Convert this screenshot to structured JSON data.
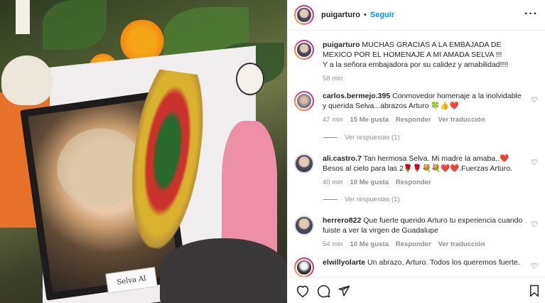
{
  "post": {
    "username": "puigarturo",
    "follow_label": "Seguir",
    "separator": "•",
    "nameplate_text": "Selva Al",
    "caption_line1": "MUCHAS GRACIAS A LA EMBAJADA DE MEXICO POR EL HOMENAJE A MI AMADA SELVA !!!",
    "caption_line2": "Y a la señora embajadora por su calidez y amabilidad!!!!",
    "caption_time": "58 min"
  },
  "comments": [
    {
      "username": "carlos.bermejo.395",
      "text": "Conmovedor homenaje a la inolvidable y querida Selva...abrazos Arturo 🍀👍❤️",
      "time": "47 min",
      "likes": "15 Me gusta",
      "reply": "Responder",
      "translate": "Ver traducción",
      "replies_label": "Ver respuestas (1)"
    },
    {
      "username": "ali.castro.7",
      "text": "Tan hermosa Selva. Mi madre la amaba..❤️Besos al cielo para las 2🌹🌹💐💐❤️❤️.Fuerzas Arturo.",
      "time": "40 min",
      "likes": "10 Me gusta",
      "reply": "Responder",
      "translate": "",
      "replies_label": "Ver respuestas (1)"
    },
    {
      "username": "herrero822",
      "text": "Que fuerte querido Arturo tu experiencia cuando fuiste a ver la virgen de Guadalupe",
      "time": "54 min",
      "likes": "10 Me gusta",
      "reply": "Responder",
      "translate": "Ver traducción"
    },
    {
      "username": "elwillyolarte",
      "text": "Un abrazo, Arturo. Todos los queremos fuerte."
    }
  ],
  "icons": {
    "more": "more-options-icon",
    "heart": "heart-icon",
    "comment": "comment-icon",
    "share": "share-icon",
    "bookmark": "bookmark-icon"
  },
  "colors": {
    "link": "#0095f6",
    "muted": "#8e8e8e",
    "text": "#262626"
  }
}
